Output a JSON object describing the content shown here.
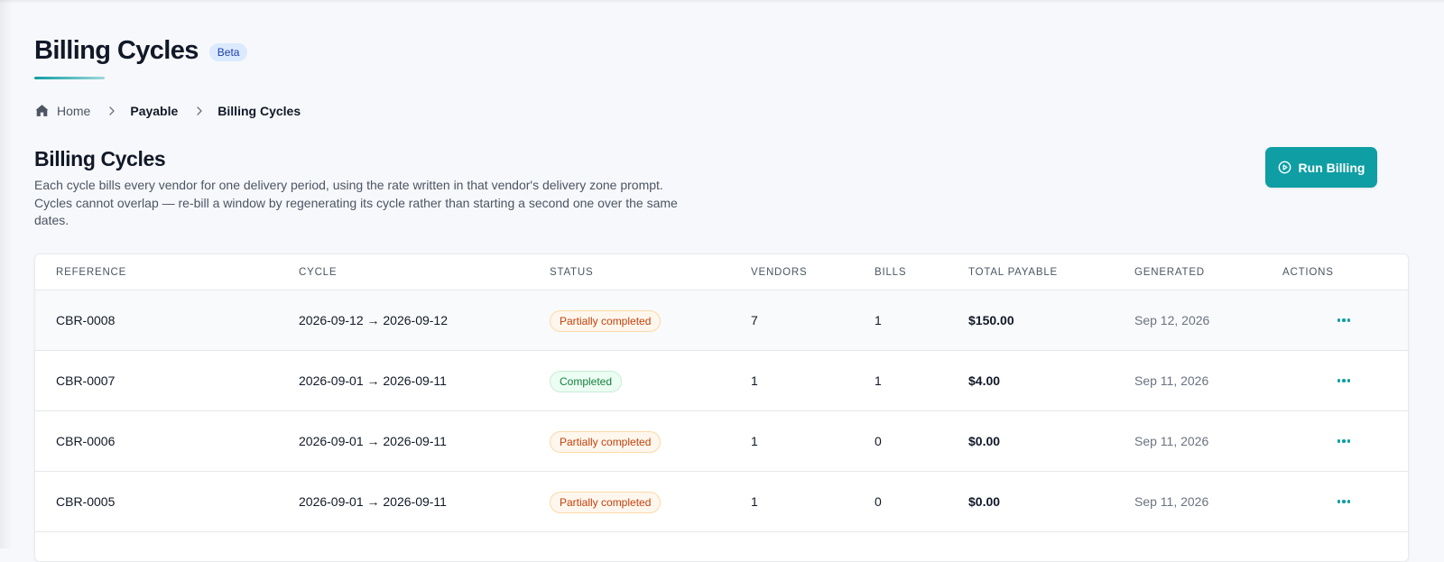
{
  "header": {
    "title": "Billing Cycles",
    "badge": "Beta"
  },
  "breadcrumb": {
    "home": "Home",
    "parent": "Payable",
    "current": "Billing Cycles"
  },
  "section": {
    "title": "Billing Cycles",
    "description": "Each cycle bills every vendor for one delivery period, using the rate written in that vendor's delivery zone prompt. Cycles cannot overlap — re-bill a window by regenerating its cycle rather than starting a second one over the same dates."
  },
  "actions": {
    "run_billing_label": "Run Billing"
  },
  "table": {
    "columns": {
      "reference": "REFERENCE",
      "cycle": "CYCLE",
      "status": "STATUS",
      "vendors": "VENDORS",
      "bills": "BILLS",
      "total": "TOTAL PAYABLE",
      "generated": "GENERATED",
      "actions": "ACTIONS"
    },
    "rows": [
      {
        "reference": "CBR-0008",
        "cycle": "2026-09-12 → 2026-09-12",
        "status": "Partially completed",
        "vendors": "7",
        "bills": "1",
        "total": "$150.00",
        "generated": "Sep 12, 2026"
      },
      {
        "reference": "CBR-0007",
        "cycle": "2026-09-01 → 2026-09-11",
        "status": "Completed",
        "vendors": "1",
        "bills": "1",
        "total": "$4.00",
        "generated": "Sep 11, 2026"
      },
      {
        "reference": "CBR-0006",
        "cycle": "2026-09-01 → 2026-09-11",
        "status": "Partially completed",
        "vendors": "1",
        "bills": "0",
        "total": "$0.00",
        "generated": "Sep 11, 2026"
      },
      {
        "reference": "CBR-0005",
        "cycle": "2026-09-01 → 2026-09-11",
        "status": "Partially completed",
        "vendors": "1",
        "bills": "0",
        "total": "$0.00",
        "generated": "Sep 11, 2026"
      }
    ]
  },
  "colors": {
    "accent": "#0e9ea3",
    "partial": "#c2410c",
    "completed": "#15803d"
  },
  "icons": {
    "home": "home-icon",
    "chevron": "chevron-right-icon",
    "run": "play-circle-icon",
    "more": "more-horizontal-icon"
  }
}
